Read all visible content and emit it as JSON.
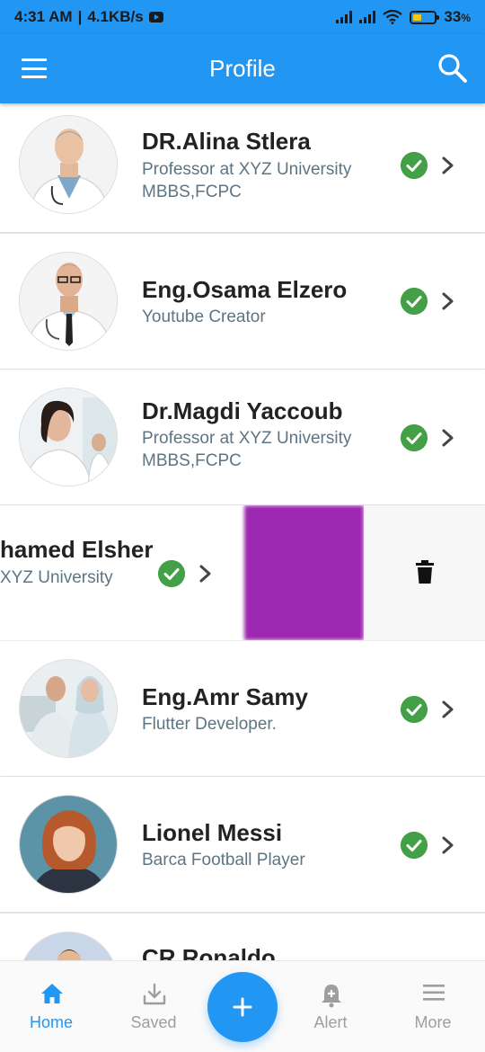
{
  "status_bar": {
    "time": "4:31 AM",
    "speed": "4.1KB/s",
    "battery": "33"
  },
  "app_bar": {
    "title": "Profile"
  },
  "profiles": [
    {
      "name": "DR.Alina Stlera",
      "line1": "Professor at XYZ University",
      "line2": "MBBS,FCPC"
    },
    {
      "name": "Eng.Osama Elzero",
      "line1": "Youtube Creator",
      "line2": ""
    },
    {
      "name": "Dr.Magdi Yaccoub",
      "line1": "Professor at XYZ University",
      "line2": "MBBS,FCPC"
    },
    {
      "name": "hamed Elsher",
      "line1": "XYZ University",
      "line2": ""
    },
    {
      "name": "Eng.Amr Samy",
      "line1": "Flutter Developer.",
      "line2": ""
    },
    {
      "name": "Lionel Messi",
      "line1": "Barca Football Player",
      "line2": ""
    },
    {
      "name": "CR.Ronaldo",
      "line1": "",
      "line2": ""
    }
  ],
  "bottom_nav": {
    "home": "Home",
    "saved": "Saved",
    "alert": "Alert",
    "more": "More"
  },
  "colors": {
    "primary": "#2196f3",
    "check": "#43a047",
    "swipe_action": "#9c27b0"
  }
}
